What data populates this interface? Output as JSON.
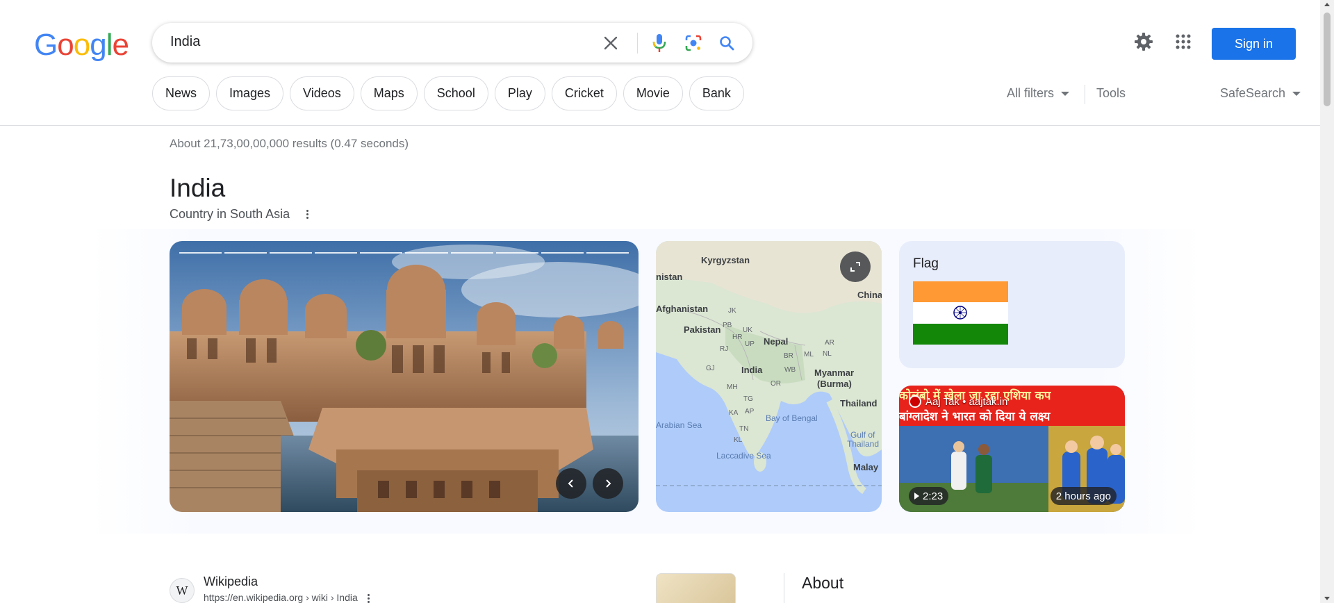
{
  "header": {
    "logo": [
      "G",
      "o",
      "o",
      "g",
      "l",
      "e"
    ],
    "logo_colors": [
      "#4285f4",
      "#ea4335",
      "#fbbc05",
      "#4285f4",
      "#34a853",
      "#ea4335"
    ],
    "search_query": "India",
    "sign_in_label": "Sign in",
    "icons": [
      "clear-icon",
      "microphone-icon",
      "google-lens-icon",
      "search-icon",
      "settings-gear-icon",
      "apps-grid-icon"
    ]
  },
  "chips": [
    "News",
    "Images",
    "Videos",
    "Maps",
    "School",
    "Play",
    "Cricket",
    "Movie",
    "Bank"
  ],
  "filters": {
    "all_filters": "All filters",
    "tools": "Tools",
    "safesearch": "SafeSearch"
  },
  "result_stats": "About 21,73,00,00,000 results (0.47 seconds)",
  "knowledge_panel": {
    "title": "India",
    "subtitle": "Country in South Asia",
    "flag_label": "Flag",
    "flag_colors": [
      "#ff9933",
      "#ffffff",
      "#138808"
    ],
    "map_labels": {
      "kyrgyzstan": "Kyrgyzstan",
      "nistan": "nistan",
      "afghanistan": "Afghanistan",
      "pakistan": "Pakistan",
      "china": "China",
      "nepal": "Nepal",
      "india": "India",
      "myanmar": "Myanmar",
      "burma": "(Burma)",
      "thailand": "Thailand",
      "arabian_sea": "Arabian Sea",
      "bay_of_bengal": "Bay of Bengal",
      "gulf_thailand_1": "Gulf of",
      "gulf_thailand_2": "Thailand",
      "laccadive_sea": "Laccadive Sea",
      "malay": "Malay",
      "jk": "JK",
      "pb": "PB",
      "uk": "UK",
      "hr": "HR",
      "up": "UP",
      "rj": "RJ",
      "br": "BR",
      "ml": "ML",
      "nl": "NL",
      "ar": "AR",
      "wb": "WB",
      "gj": "GJ",
      "mh": "MH",
      "or": "OR",
      "tg": "TG",
      "ka": "KA",
      "ap": "AP",
      "tn": "TN",
      "kl": "KL"
    },
    "video": {
      "source": "Aaj Tak • aajtak.in",
      "duration": "2:23",
      "age": "2 hours ago",
      "headline_top": "कोलंबो में खेला जा रहा एशिया कप",
      "headline_bottom": "बांग्लादेश ने भारत को दिया ये लक्ष्य"
    },
    "photo_slides": 10
  },
  "first_result": {
    "logo_letter": "W",
    "site_name": "Wikipedia",
    "url": "https://en.wikipedia.org › wiki › India"
  },
  "about_heading": "About"
}
